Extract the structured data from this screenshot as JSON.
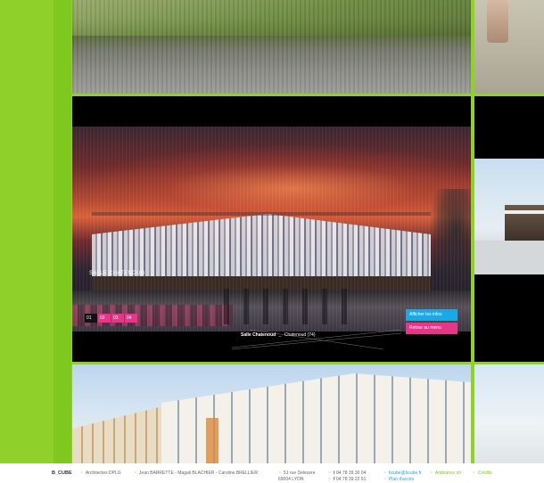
{
  "project": {
    "sign": "SALLE CHATENOUD",
    "caption_title": "Salle Chatenoud",
    "caption_separator": "_",
    "caption_location": "Chatenoud (74)"
  },
  "pager": {
    "items": [
      "01",
      "02",
      "03",
      "04"
    ],
    "active_index": 0
  },
  "buttons": {
    "info": "Afficher les infos",
    "menu": "Retour au menu"
  },
  "footer": {
    "brand": "B_CUBE",
    "architects": "Architectes DPLG",
    "names": "Jean BARRETTE - Magali BLACHIER - Caroline BRELLIER",
    "address_line1": "51 rue Deleuvre",
    "address_line2": "69004 LYON",
    "tel_prefix": "t",
    "tel": "04 78 39 30 04",
    "fax_prefix": "f",
    "fax": "04 78 39 22 91",
    "email": "bcube@bcube.fr",
    "map": "Plan d'accès",
    "ambiance": "Ambiance on",
    "credits": "Crédits"
  },
  "colors": {
    "green": "#8fd12a",
    "magenta": "#e8358a",
    "cyan": "#1aa8e8",
    "black": "#000000"
  },
  "icons": {
    "separator": "tilde-separator-icon"
  }
}
